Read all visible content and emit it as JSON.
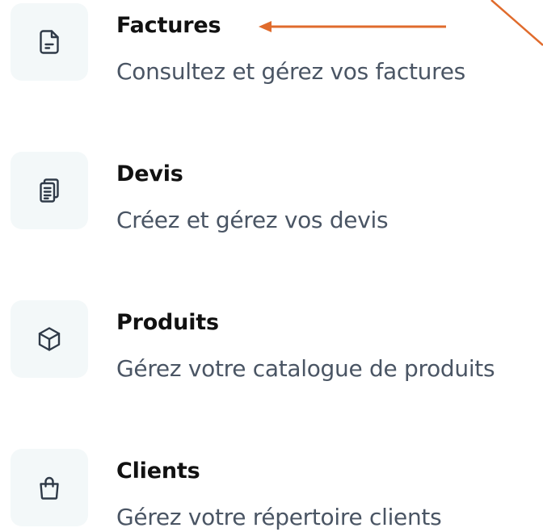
{
  "items": [
    {
      "title": "Factures",
      "description": "Consultez et gérez vos factures",
      "icon": "invoice-file-icon"
    },
    {
      "title": "Devis",
      "description": "Créez et gérez vos devis",
      "icon": "clipboard-quote-icon"
    },
    {
      "title": "Produits",
      "description": "Gérez votre catalogue de produits",
      "icon": "product-box-icon"
    },
    {
      "title": "Clients",
      "description": "Gérez votre répertoire clients",
      "icon": "shopping-bag-icon"
    }
  ],
  "colors": {
    "icon_bg": "#f3f8f9",
    "title": "#111111",
    "description": "#4a5564",
    "icon_stroke": "#2f3a48",
    "annotation": "#e06b2c"
  }
}
